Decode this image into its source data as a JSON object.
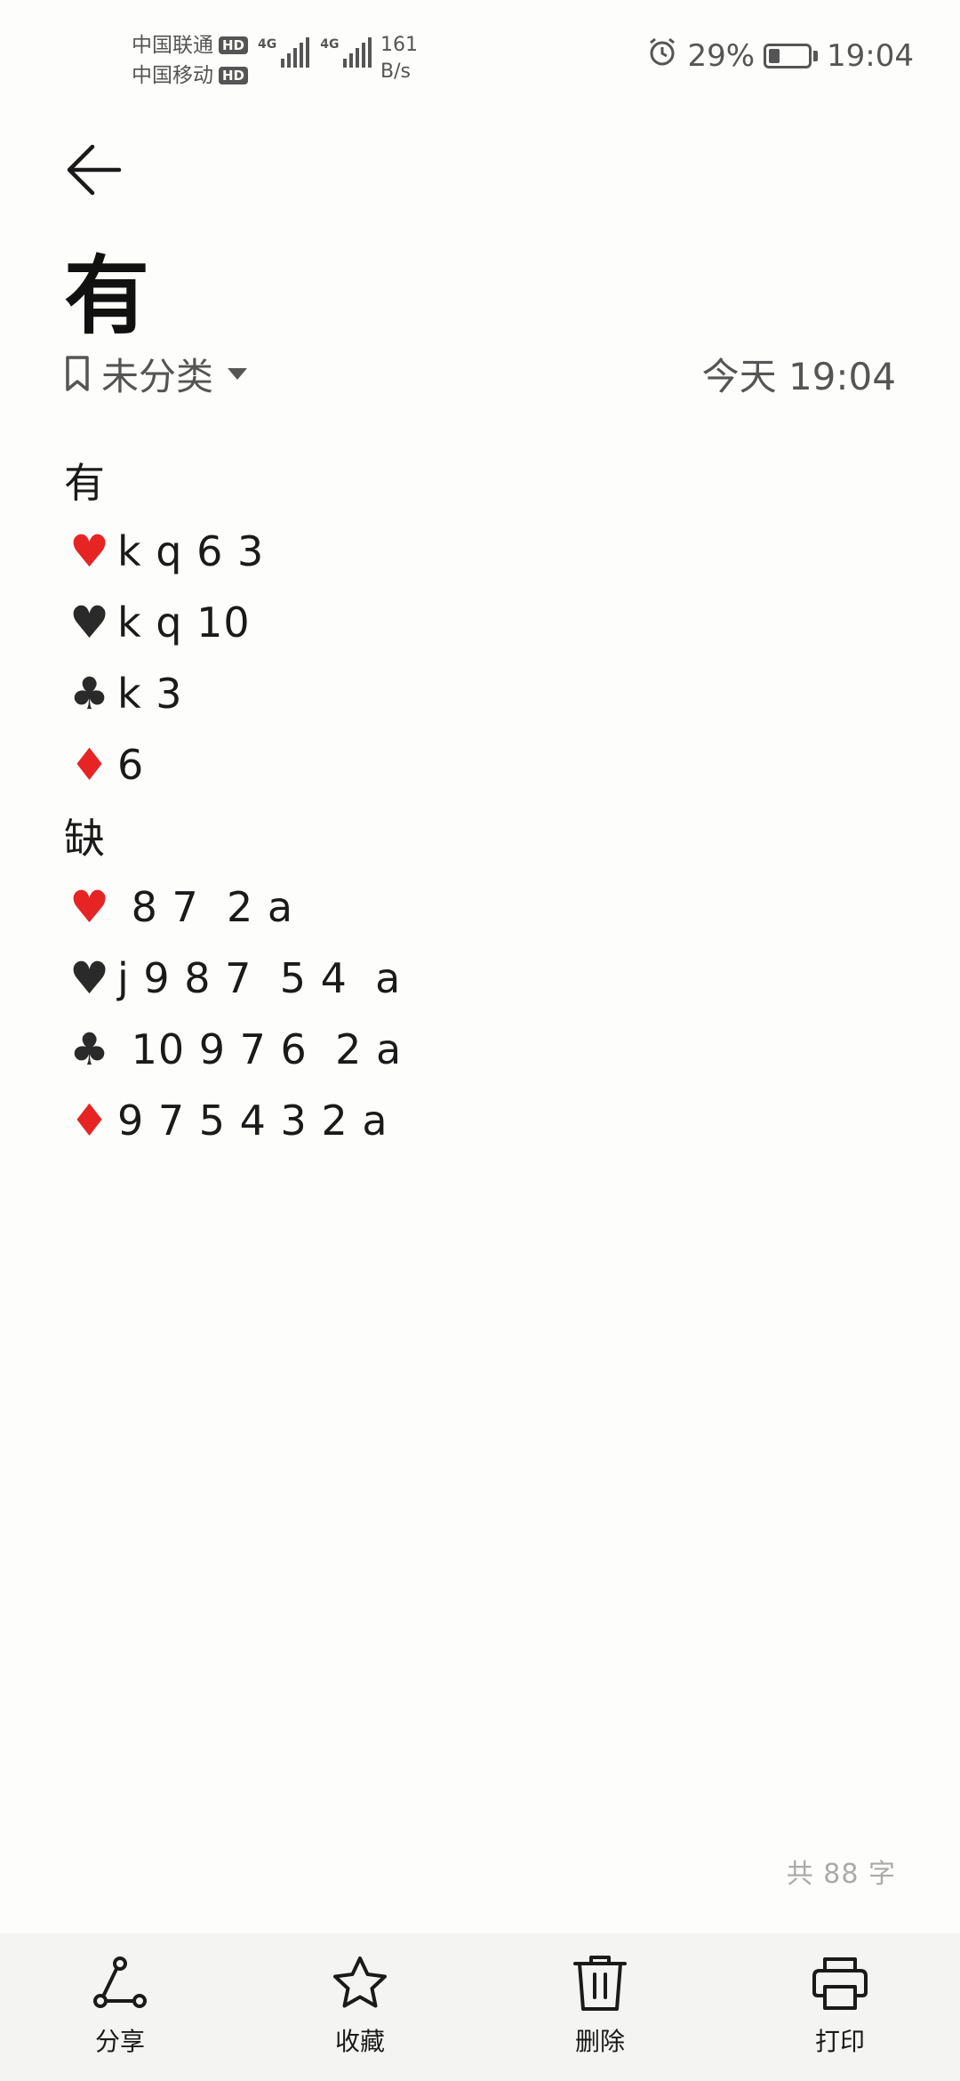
{
  "status_bar": {
    "carrier1": "中国联通",
    "carrier2": "中国移动",
    "hd": "HD",
    "net_type": "4G",
    "speed_value": "161",
    "speed_unit": "B/s",
    "battery": "29%",
    "battery_level": 0.29,
    "time": "19:04"
  },
  "note": {
    "title": "有",
    "category": "未分类",
    "timestamp": "今天 19:04",
    "lines": [
      {
        "suit": "",
        "suit_color": "",
        "text": "有"
      },
      {
        "suit": "♥",
        "suit_color": "red",
        "text": "k q 6 3"
      },
      {
        "suit": "♥",
        "suit_color": "black",
        "text": "k q 10"
      },
      {
        "suit": "♣",
        "suit_color": "black",
        "text": "k 3"
      },
      {
        "suit": "♦",
        "suit_color": "red",
        "text": "6"
      },
      {
        "suit": "",
        "suit_color": "",
        "text": "缺"
      },
      {
        "suit": "♥",
        "suit_color": "red",
        "text": " 8 7  2 a"
      },
      {
        "suit": "♥",
        "suit_color": "black",
        "text": "j 9 8 7  5 4  a"
      },
      {
        "suit": "♣",
        "suit_color": "black",
        "text": " 10 9 7 6  2 a"
      },
      {
        "suit": "♦",
        "suit_color": "red",
        "text": "9 7 5 4 3 2 a"
      }
    ],
    "word_count": "共 88 字"
  },
  "toolbar": {
    "share": "分享",
    "favorite": "收藏",
    "delete": "删除",
    "print": "打印"
  },
  "icons": {
    "back": "arrow-left-icon",
    "category": "bookmark-icon",
    "share": "share-icon",
    "favorite": "star-icon",
    "delete": "trash-icon",
    "print": "printer-icon"
  }
}
